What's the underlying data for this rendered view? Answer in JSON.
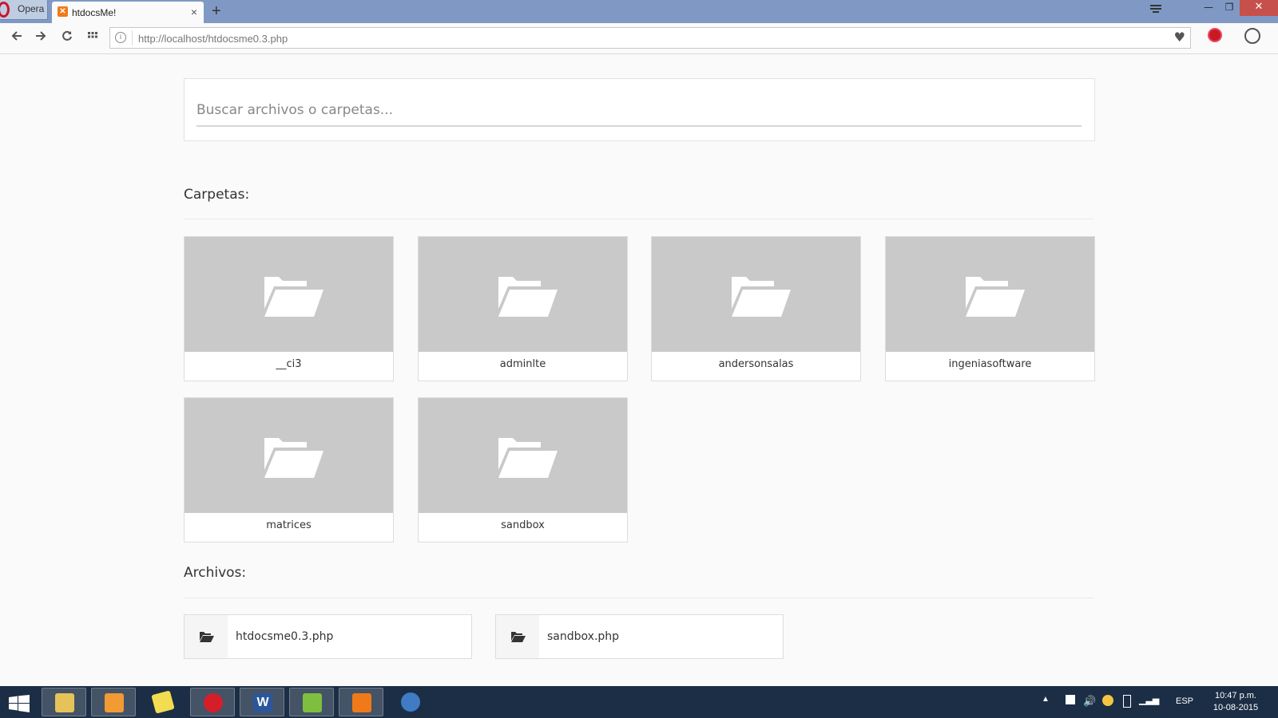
{
  "browser": {
    "menu_label": "Opera",
    "tab_title": "htdocsMe!",
    "tab_close": "×",
    "new_tab": "+",
    "url": "http://localhost/htdocsme0.3.php"
  },
  "search": {
    "placeholder": "Buscar archivos o carpetas..."
  },
  "folders_section": {
    "title": "Carpetas:",
    "items": [
      {
        "name": "__ci3"
      },
      {
        "name": "adminlte"
      },
      {
        "name": "andersonsalas"
      },
      {
        "name": "ingeniasoftware"
      },
      {
        "name": "matrices"
      },
      {
        "name": "sandbox"
      }
    ]
  },
  "files_section": {
    "title": "Archivos:",
    "items": [
      {
        "name": "htdocsme0.3.php"
      },
      {
        "name": "sandbox.php"
      }
    ]
  },
  "taskbar": {
    "language": "ESP",
    "time": "10:47 p.m.",
    "date": "10-08-2015"
  },
  "colors": {
    "titlebar": "#7f99c4",
    "folder_thumb": "#c9c9c9",
    "taskbar": "#1c2e45",
    "close_button": "#c7504c"
  }
}
